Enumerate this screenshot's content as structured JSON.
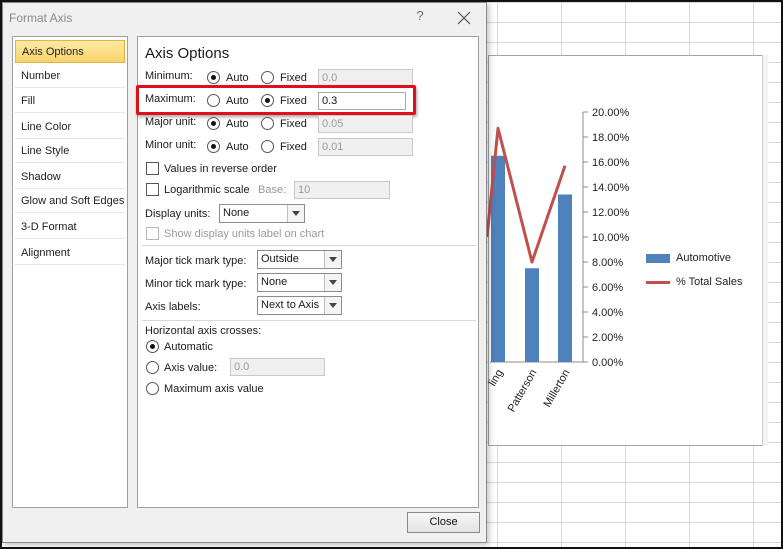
{
  "dialog": {
    "title": "Format Axis",
    "help_symbol": "?",
    "close_label": "Close"
  },
  "nav": {
    "items": [
      {
        "label": "Axis Options",
        "selected": true
      },
      {
        "label": "Number"
      },
      {
        "label": "Fill"
      },
      {
        "label": "Line Color"
      },
      {
        "label": "Line Style"
      },
      {
        "label": "Shadow"
      },
      {
        "label": "Glow and Soft Edges"
      },
      {
        "label": "3-D Format"
      },
      {
        "label": "Alignment"
      }
    ]
  },
  "panel": {
    "title": "Axis Options",
    "rows": {
      "minimum": {
        "label": "Minimum:",
        "auto": "Auto",
        "fixed": "Fixed",
        "value": "0.0",
        "selected": "auto"
      },
      "maximum": {
        "label": "Maximum:",
        "auto": "Auto",
        "fixed": "Fixed",
        "value": "0.3",
        "selected": "fixed"
      },
      "major_unit": {
        "label": "Major unit:",
        "auto": "Auto",
        "fixed": "Fixed",
        "value": "0.05",
        "selected": "auto"
      },
      "minor_unit": {
        "label": "Minor unit:",
        "auto": "Auto",
        "fixed": "Fixed",
        "value": "0.01",
        "selected": "auto"
      }
    },
    "reverse_order": "Values in reverse order",
    "log_scale": "Logarithmic scale",
    "base_label": "Base:",
    "base_value": "10",
    "display_units_label": "Display units:",
    "display_units_value": "None",
    "show_units_label": "Show display units label on chart",
    "major_tick_label": "Major tick mark type:",
    "major_tick_value": "Outside",
    "minor_tick_label": "Minor tick mark type:",
    "minor_tick_value": "None",
    "axis_labels_label": "Axis labels:",
    "axis_labels_value": "Next to Axis",
    "crosses_label": "Horizontal axis crosses:",
    "crosses_automatic": "Automatic",
    "crosses_axis_value": "Axis value:",
    "crosses_axis_value_input": "0.0",
    "crosses_max": "Maximum axis value"
  },
  "chart_data": {
    "type": "bar",
    "categories": [
      "ling",
      "Patterson",
      "Millerton"
    ],
    "series": [
      {
        "name": "Automotive",
        "type": "bar",
        "values": [
          0.165,
          0.075,
          0.134
        ]
      },
      {
        "name": "% Total Sales",
        "type": "line",
        "values": [
          0.187,
          0.08,
          0.157
        ]
      }
    ],
    "line_entry_point": 0.1,
    "y2_ticks": [
      "0.00%",
      "2.00%",
      "4.00%",
      "6.00%",
      "8.00%",
      "10.00%",
      "12.00%",
      "14.00%",
      "16.00%",
      "18.00%",
      "20.00%"
    ],
    "ylim": [
      0,
      0.2
    ],
    "legend": "right",
    "colors": {
      "bar": "#4f81bd",
      "line": "#c0504d"
    }
  }
}
